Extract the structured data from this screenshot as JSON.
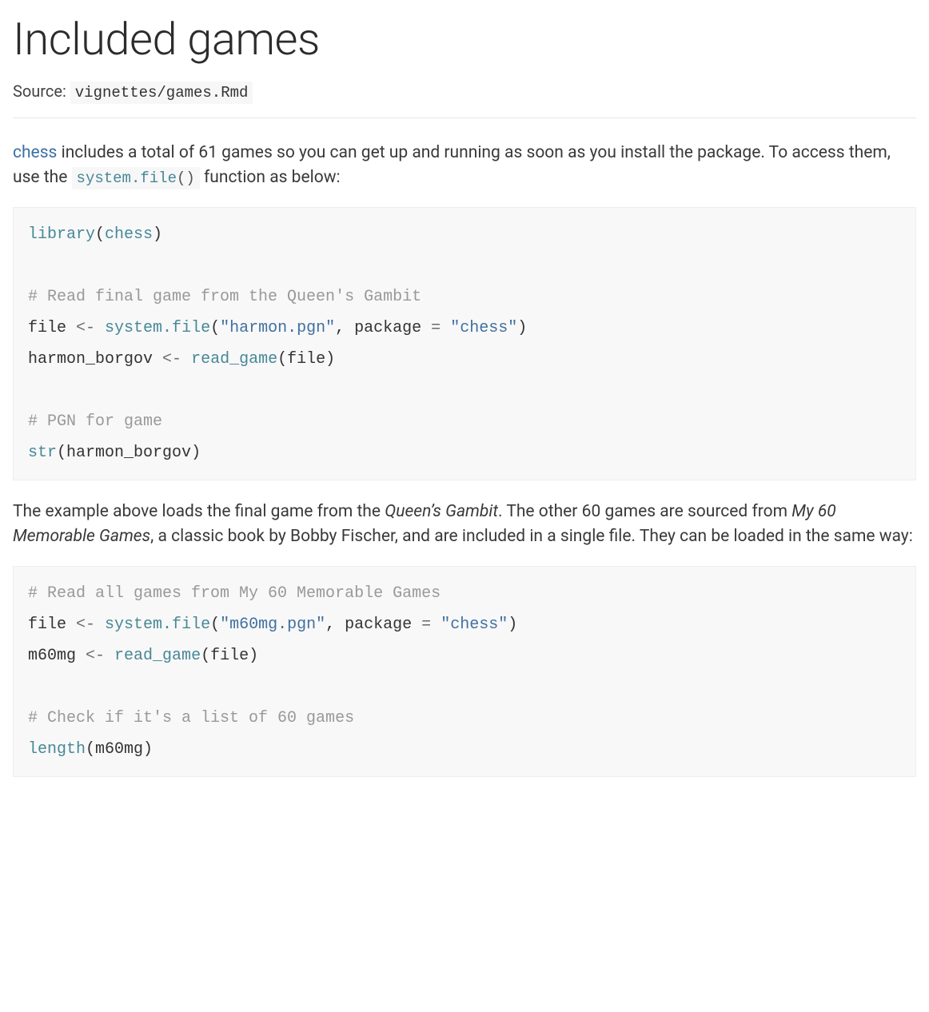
{
  "title": "Included games",
  "source_label": "Source: ",
  "source_path": "vignettes/games.Rmd",
  "intro": {
    "link_text": "chess",
    "text_a": " includes a total of 61 games so you can get up and running as soon as you install the package. To access them, use the ",
    "inline_fn": "system.file",
    "inline_parens": "()",
    "text_b": " function as below:"
  },
  "code1": {
    "l1_fn": "library",
    "l1_open": "(",
    "l1_arg": "chess",
    "l1_close": ")",
    "c1": "# Read final game from the Queen's Gambit",
    "l2_id": "file ",
    "l2_op": "<-",
    "l2_sp": " ",
    "l2_fn": "system.file",
    "l2_open": "(",
    "l2_s1": "\"harmon.pgn\"",
    "l2_comma": ", package ",
    "l2_eq": "=",
    "l2_sp2": " ",
    "l2_s2": "\"chess\"",
    "l2_close": ")",
    "l3_id": "harmon_borgov ",
    "l3_op": "<-",
    "l3_sp": " ",
    "l3_fn": "read_game",
    "l3_open": "(",
    "l3_arg": "file",
    "l3_close": ")",
    "c2": "# PGN for game",
    "l4_fn": "str",
    "l4_open": "(",
    "l4_arg": "harmon_borgov",
    "l4_close": ")"
  },
  "mid": {
    "a": "The example above loads the final game from the ",
    "em1": "Queen’s Gambit",
    "b": ". The other 60 games are sourced from ",
    "em2": "My 60 Memorable Games",
    "c": ", a classic book by Bobby Fischer, and are included in a single file. They can be loaded in the same way:"
  },
  "code2": {
    "c1": "# Read all games from My 60 Memorable Games",
    "l1_id": "file ",
    "l1_op": "<-",
    "l1_sp": " ",
    "l1_fn": "system.file",
    "l1_open": "(",
    "l1_s1": "\"m60mg.pgn\"",
    "l1_comma": ", package ",
    "l1_eq": "=",
    "l1_sp2": " ",
    "l1_s2": "\"chess\"",
    "l1_close": ")",
    "l2_id": "m60mg ",
    "l2_op": "<-",
    "l2_sp": " ",
    "l2_fn": "read_game",
    "l2_open": "(",
    "l2_arg": "file",
    "l2_close": ")",
    "c2": "# Check if it's a list of 60 games",
    "l3_fn": "length",
    "l3_open": "(",
    "l3_arg": "m60mg",
    "l3_close": ")"
  }
}
